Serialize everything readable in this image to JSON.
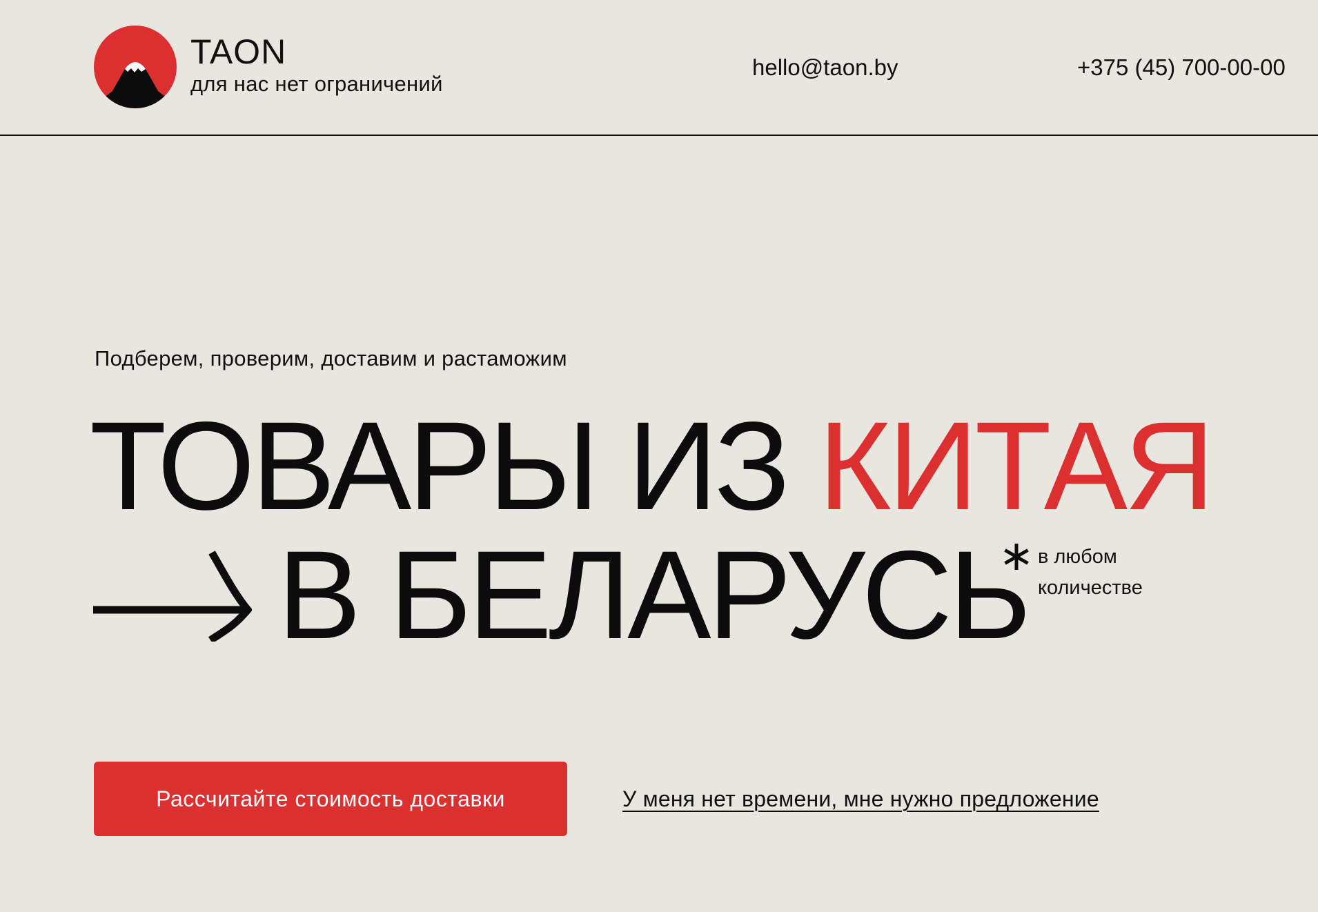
{
  "header": {
    "brand_name": "TAON",
    "tagline": "для нас нет ограничений",
    "email": "hello@taon.by",
    "phone": "+375 (45) 700-00-00"
  },
  "hero": {
    "subtitle": "Подберем, проверим, доставим и растаможим",
    "title_part1": "ТОВАРЫ ИЗ ",
    "title_accent": "КИТАЯ",
    "title_line2": "В БЕЛАРУСЬ",
    "note_line1": "в любом",
    "note_line2": "количестве"
  },
  "cta": {
    "primary_label": "Рассчитайте стоимость доставки",
    "secondary_label": "У меня нет времени, мне нужно предложение"
  },
  "colors": {
    "background": "#e9e6e0",
    "accent": "#dc2f2f",
    "text": "#111111"
  },
  "icons": {
    "logo": "mountain-sun-logo-icon",
    "arrow": "arrow-right-icon",
    "asterisk": "asterisk-icon"
  }
}
